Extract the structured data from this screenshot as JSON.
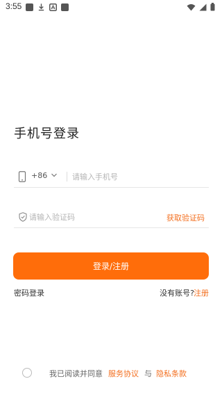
{
  "status_bar": {
    "time": "3:55",
    "left_icons": [
      "notification-square-icon",
      "download-icon",
      "font-badge-icon",
      "notification-square-icon"
    ],
    "right_icons": [
      "wifi-icon",
      "signal-icon",
      "battery-icon"
    ]
  },
  "page": {
    "title": "手机号登录"
  },
  "phone_field": {
    "icon": "phone-icon",
    "country_code": "+86",
    "placeholder": "请输入手机号",
    "value": ""
  },
  "code_field": {
    "icon": "shield-check-icon",
    "placeholder": "请输入验证码",
    "value": "",
    "get_code_label": "获取验证码"
  },
  "login_button": {
    "label": "登录/注册",
    "color": "#ff6d0a"
  },
  "links": {
    "password_login": "密码登录",
    "no_account": "没有账号?",
    "register": "注册"
  },
  "agreement": {
    "checked": false,
    "prefix": "我已阅读并同意",
    "service": "服务协议",
    "and": "与",
    "privacy": "隐私条款"
  },
  "colors": {
    "accent": "#f37021",
    "primary_button": "#ff6d0a"
  }
}
